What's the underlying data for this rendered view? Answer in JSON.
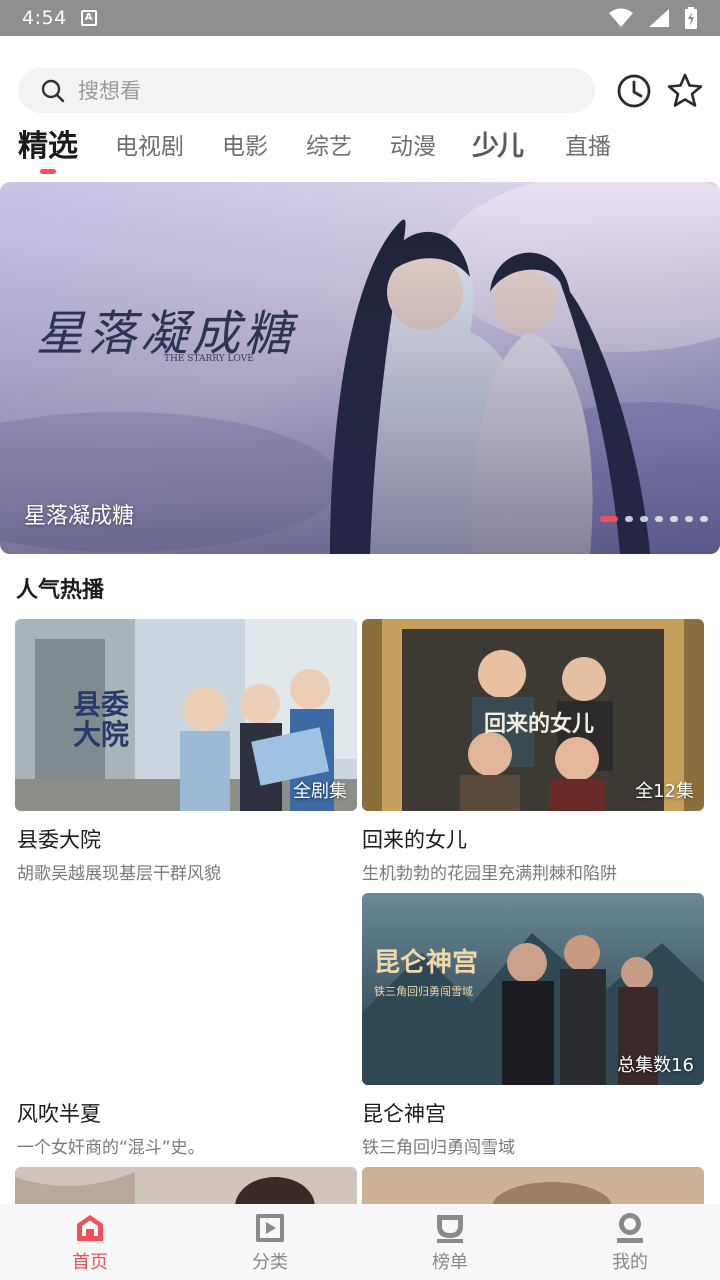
{
  "status_bar": {
    "time": "4:54",
    "notif_icon_letter": "A"
  },
  "search": {
    "placeholder": "搜想看"
  },
  "header_icons": [
    "history-icon",
    "star-icon"
  ],
  "tabs": [
    {
      "label": "精选",
      "active": true
    },
    {
      "label": "电视剧"
    },
    {
      "label": "电影"
    },
    {
      "label": "综艺"
    },
    {
      "label": "动漫"
    },
    {
      "label": "少儿"
    },
    {
      "label": "直播"
    }
  ],
  "banner": {
    "title": "星落凝成糖",
    "calligraphy": "星落凝成糖",
    "calligraphy_sub": "THE STARRY LOVE",
    "page_count": 7,
    "active_page": 1
  },
  "section": {
    "title": "人气热播"
  },
  "cards": [
    {
      "name": "县委大院",
      "desc": "胡歌吴越展现基层干群风貌",
      "badge": "全剧集",
      "poster_text": "县委大院"
    },
    {
      "name": "回来的女儿",
      "desc": "生机勃勃的花园里充满荆棘和陷阱",
      "badge": "全12集",
      "poster_text": "回来的女儿"
    },
    {
      "name": "风吹半夏",
      "desc": "一个女奸商的“混斗”史。",
      "badge": ""
    },
    {
      "name": "昆仑神宫",
      "desc": "铁三角回归勇闯雪域",
      "badge": "总集数16",
      "poster_text": "昆仑神宫"
    }
  ],
  "bottom_nav": [
    {
      "label": "首页",
      "icon": "home-icon",
      "active": true
    },
    {
      "label": "分类",
      "icon": "category-icon"
    },
    {
      "label": "榜单",
      "icon": "ranking-icon"
    },
    {
      "label": "我的",
      "icon": "profile-icon"
    }
  ],
  "colors": {
    "accent": "#f0505a",
    "text": "#1b1b1b",
    "muted": "#7a7a7a"
  }
}
